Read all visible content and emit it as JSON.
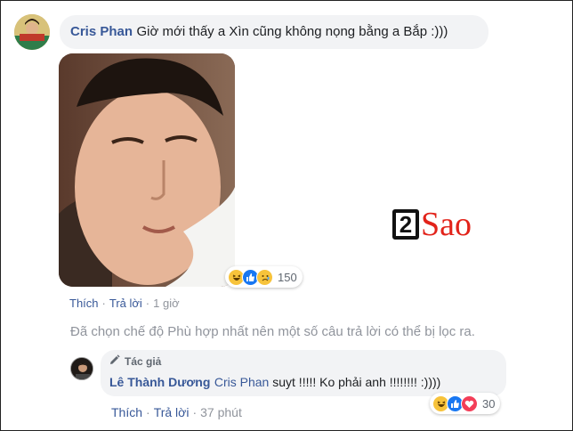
{
  "comment": {
    "author": "Cris Phan",
    "text": "Giờ mới thấy a Xìn cũng không nọng bằng a Bắp :)))",
    "reaction_count": "150",
    "reactions": [
      "haha-icon",
      "like-icon",
      "sad-icon"
    ],
    "actions": {
      "like": "Thích",
      "reply": "Trả lời",
      "time": "1 giờ"
    }
  },
  "filter_note": "Đã chọn chế độ Phù hợp nhất nên một số câu trả lời có thể bị lọc ra.",
  "reply": {
    "badge": "Tác giả",
    "author": "Lê Thành Dương",
    "tag": "Cris Phan",
    "text": " suyt !!!!! Ko phải anh !!!!!!!! :))))",
    "reaction_count": "30",
    "reactions": [
      "haha-icon",
      "like-icon",
      "love-icon"
    ],
    "actions": {
      "like": "Thích",
      "reply": "Trả lời",
      "time": "37 phút"
    }
  },
  "watermark": {
    "number": "2",
    "word": "Sao"
  },
  "colors": {
    "link": "#385898",
    "bubble": "#f2f3f5",
    "muted": "#90949c",
    "watermark_red": "#e2231a"
  }
}
